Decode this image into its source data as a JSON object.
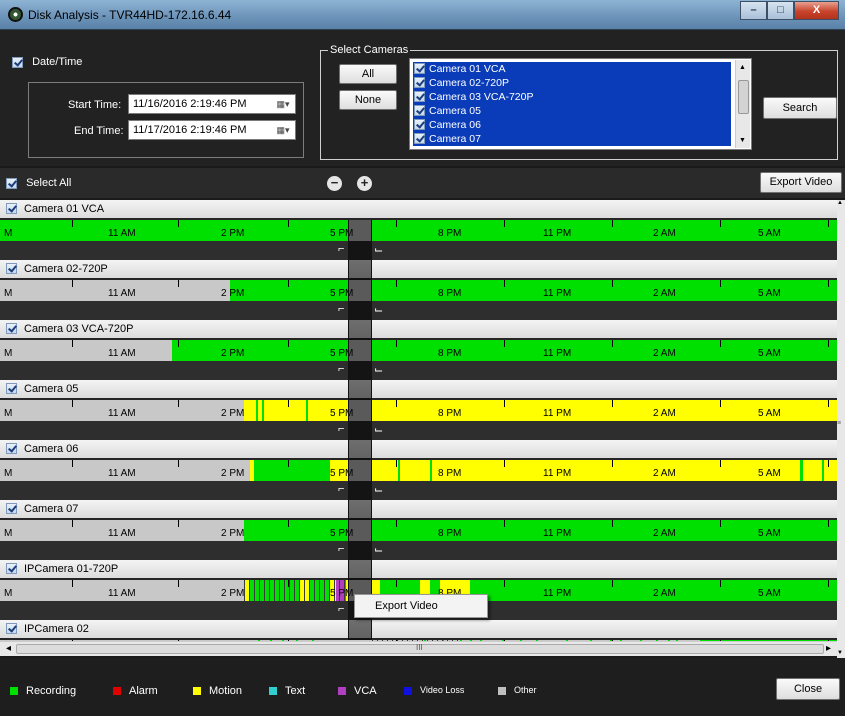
{
  "window": {
    "title": "Disk Analysis - TVR44HD-172.16.6.44",
    "minimize": "–",
    "maximize": "□",
    "close": "X"
  },
  "datetime": {
    "checkbox_label": "Date/Time",
    "start_label": "Start Time:",
    "start_value": "11/16/2016  2:19:46 PM",
    "end_label": "End Time:",
    "end_value": "11/17/2016  2:19:46 PM",
    "calendar_glyph": "▦▾"
  },
  "select_cameras": {
    "legend": "Select Cameras",
    "all_label": "All",
    "none_label": "None",
    "items": [
      "Camera 01 VCA",
      "Camera 02-720P",
      "Camera 03 VCA-720P",
      "Camera 05",
      "Camera 06",
      "Camera 07"
    ]
  },
  "search_label": "Search",
  "toolbar": {
    "select_all_label": "Select All",
    "zoom_out": "−",
    "zoom_in": "+",
    "export_label": "Export Video"
  },
  "timeline_labels": [
    "M",
    "11 AM",
    "2 PM",
    "5 PM",
    "8 PM",
    "11 PM",
    "2 AM",
    "5 AM"
  ],
  "cameras": [
    {
      "name": "Camera 01 VCA"
    },
    {
      "name": "Camera 02-720P"
    },
    {
      "name": "Camera 03 VCA-720P"
    },
    {
      "name": "Camera 05"
    },
    {
      "name": "Camera 06"
    },
    {
      "name": "Camera 07"
    },
    {
      "name": "IPCamera 01-720P"
    },
    {
      "name": "IPCamera 02"
    }
  ],
  "context_menu": {
    "export_label": "Export Video"
  },
  "scroll": {
    "left": "◂",
    "right": "▸",
    "grip": "III"
  },
  "legend": {
    "recording": "Recording",
    "alarm": "Alarm",
    "motion": "Motion",
    "text": "Text",
    "vca": "VCA",
    "video_loss": "Video Loss",
    "other": "Other",
    "close_label": "Close"
  },
  "colors": {
    "recording": "#00e000",
    "alarm": "#e00000",
    "motion": "#ffff00",
    "text": "#30d0d0",
    "vca": "#b040c0",
    "video_loss": "#1010e0",
    "other": "#bfbfbf"
  }
}
